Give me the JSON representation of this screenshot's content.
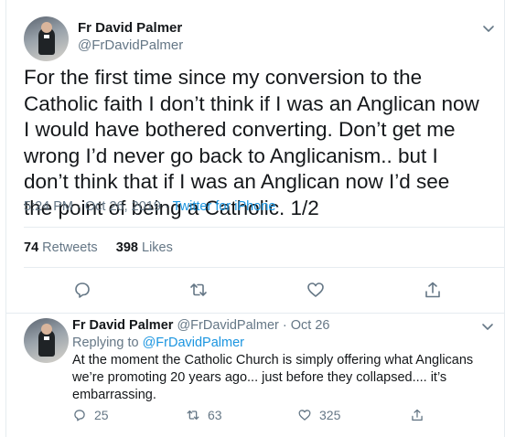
{
  "main_tweet": {
    "author_name": "Fr David Palmer",
    "author_handle": "@FrDavidPalmer",
    "text": "For the first time since my conversion to the Catholic faith I don’t think if I was an Anglican now I would have bothered converting. Don’t get me wrong I’d never go back to Anglicanism.. but I don’t think that if I was an Anglican now I’d see the point of being a Catholic. 1/2",
    "time": "5:24 PM",
    "dot": "·",
    "date": "Oct 26, 2019",
    "source": "Twitter for iPhone",
    "retweets_count": "74",
    "retweets_label": "Retweets",
    "likes_count": "398",
    "likes_label": "Likes",
    "actions": [
      "reply-icon",
      "retweet-icon",
      "heart-icon",
      "share-icon"
    ]
  },
  "reply_tweet": {
    "author_name": "Fr David Palmer",
    "author_handle": "@FrDavidPalmer",
    "dot": "·",
    "date": "Oct 26",
    "replying_prefix": "Replying to",
    "replying_to": "@FrDavidPalmer",
    "text": "At the moment the Catholic Church is simply offering what Anglicans we’re promoting 20 years ago... just before they collapsed.... it’s embarrassing.",
    "reply_count": "25",
    "retweet_count": "63",
    "like_count": "325"
  },
  "colors": {
    "text": "#14171a",
    "secondary": "#657786",
    "link": "#1b95e0",
    "border": "#e6ecf0"
  }
}
